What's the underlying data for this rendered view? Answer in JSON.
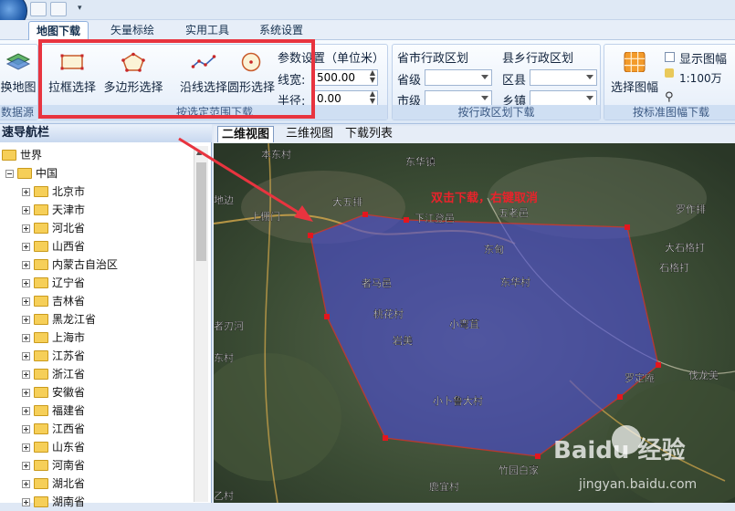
{
  "menu": {
    "tabs": [
      "地图下载",
      "矢量标绘",
      "实用工具",
      "系统设置"
    ]
  },
  "ribbon": {
    "datasource": {
      "button_label": "换地图",
      "group_label": "数据源"
    },
    "range_group": {
      "buttons": [
        "拉框选择",
        "多边形选择",
        "沿线选择",
        "圆形选择"
      ],
      "group_label": "按选定范围下载"
    },
    "params": {
      "title": "参数设置（单位米）",
      "line_width_label": "线宽:",
      "line_width_value": "500.00",
      "radius_label": "半径:",
      "radius_value": "0.00"
    },
    "admin_city": {
      "title": "省市行政区划",
      "province_label": "省级",
      "city_label": "市级"
    },
    "admin_county": {
      "title": "县乡行政区划",
      "county_label": "区县",
      "town_label": "乡镇",
      "group_label": "按行政区划下载"
    },
    "sheet": {
      "button_label": "选择图幅",
      "checkbox_label": "显示图幅",
      "scale_value": "1:100万",
      "group_label": "按标准图幅下载"
    }
  },
  "navigator": {
    "title": "速导航栏",
    "tree": {
      "root": "世界",
      "country": "中国",
      "provinces": [
        "北京市",
        "天津市",
        "河北省",
        "山西省",
        "内蒙古自治区",
        "辽宁省",
        "吉林省",
        "黑龙江省",
        "上海市",
        "江苏省",
        "浙江省",
        "安徽省",
        "福建省",
        "江西省",
        "山东省",
        "河南省",
        "湖北省",
        "湖南省"
      ]
    }
  },
  "view_tabs": [
    "二维视图",
    "三维视图",
    "下载列表"
  ],
  "map": {
    "hint": "双击下载，右键取消",
    "places": [
      "本东村",
      "东华镇",
      "大五排",
      "下江登邑",
      "五老邑",
      "上棚门",
      "东甸",
      "者马邑",
      "东华村",
      "桃花村",
      "小弯苴",
      "岩美",
      "小卜鲁大村",
      "罗定庵",
      "大石格打",
      "石格打",
      "罗作排",
      "伐龙美",
      "竹园白家",
      "鹿宜村",
      "地边",
      "者刃河",
      "东村",
      "乙村"
    ],
    "watermark": "Baidu 经验",
    "watermark_sub": "jingyan.baidu.com"
  },
  "colors": {
    "highlight": "#e8343f",
    "polygon_fill": "#4b4bd2",
    "polygon_stroke": "#ff2a2a"
  }
}
